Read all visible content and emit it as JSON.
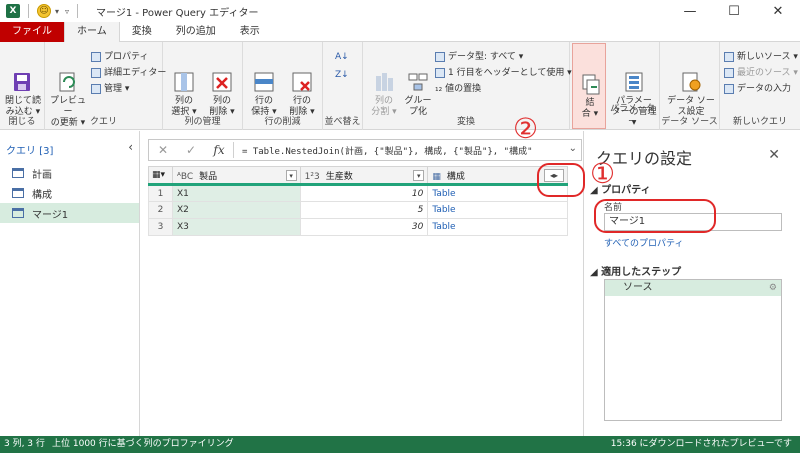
{
  "window": {
    "title": "マージ1 - Power Query エディター",
    "app_icon": "X",
    "min": "—",
    "max": "☐",
    "close": "✕"
  },
  "tabs": [
    "ファイル",
    "ホーム",
    "変換",
    "列の追加",
    "表示"
  ],
  "ribbon": {
    "close": {
      "btn": "閉じて読\nみ込む ▾",
      "label": "閉じる"
    },
    "query": {
      "preview": "プレビュー\nの更新 ▾",
      "props": "プロパティ",
      "adv": "詳細エディター",
      "manage": "管理 ▾",
      "label": "クエリ"
    },
    "cols": {
      "select": "列の\n選択 ▾",
      "remove": "列の\n削除 ▾",
      "label": "列の管理"
    },
    "rows": {
      "keep": "行の\n保持 ▾",
      "remove": "行の\n削除 ▾",
      "label": "行の削減"
    },
    "sort": {
      "label": "並べ替え"
    },
    "transform": {
      "split": "列の\n分割 ▾",
      "group": "グルー\nプ化",
      "dtype": "データ型: すべて ▾",
      "header": "1 行目をヘッダーとして使用 ▾",
      "replace": "₁₂ 値の置換",
      "label": "変換"
    },
    "combine": {
      "btn": "結\n合 ▾",
      "label": ""
    },
    "params": {
      "btn": "パラメー\nターの管理 ▾",
      "label": "パラメーター"
    },
    "datasrc": {
      "btn": "データ ソー\nス設定",
      "label": "データ ソース"
    },
    "newq": {
      "new": "新しいソース ▾",
      "recent": "最近のソース ▾",
      "enter": "データの入力",
      "label": "新しいクエリ"
    }
  },
  "formula": {
    "cancel": "✕",
    "confirm": "✓",
    "fx": "fx",
    "text": "= Table.NestedJoin(計画, {\"製品\"}, 構成, {\"製品\"}, \"構成\"",
    "expand": "⌄"
  },
  "queries": {
    "header": "クエリ [3]",
    "collapse": "‹",
    "items": [
      "計画",
      "構成",
      "マージ1"
    ]
  },
  "grid": {
    "corner": "▦▾",
    "columns": [
      {
        "type_icon": "ᴬBC",
        "name": "製品"
      },
      {
        "type_icon": "1²3",
        "name": "生産数"
      },
      {
        "type_icon": "▦",
        "name": "構成"
      }
    ],
    "drop": "▾",
    "expand": "◂▸",
    "rows": [
      {
        "n": "1",
        "product": "X1",
        "qty": "10",
        "comp": "Table"
      },
      {
        "n": "2",
        "product": "X2",
        "qty": "5",
        "comp": "Table"
      },
      {
        "n": "3",
        "product": "X3",
        "qty": "30",
        "comp": "Table"
      }
    ]
  },
  "settings": {
    "title": "クエリの設定",
    "close": "✕",
    "props_section": "◢ プロパティ",
    "name_label": "名前",
    "name_value": "マージ1",
    "all_props": "すべてのプロパティ",
    "steps_section": "◢ 適用したステップ",
    "steps": [
      "ソース"
    ],
    "gear": "⚙"
  },
  "annotations": {
    "one": "①",
    "two": "②"
  },
  "status": {
    "dims": "3 列, 3 行",
    "profiling": "上位 1000 行に基づく列のプロファイリング",
    "right": "15:36 にダウンロードされたプレビューです"
  },
  "colors": {
    "accent": "#217346",
    "file_tab": "#c00000",
    "annotation": "#e02828"
  }
}
